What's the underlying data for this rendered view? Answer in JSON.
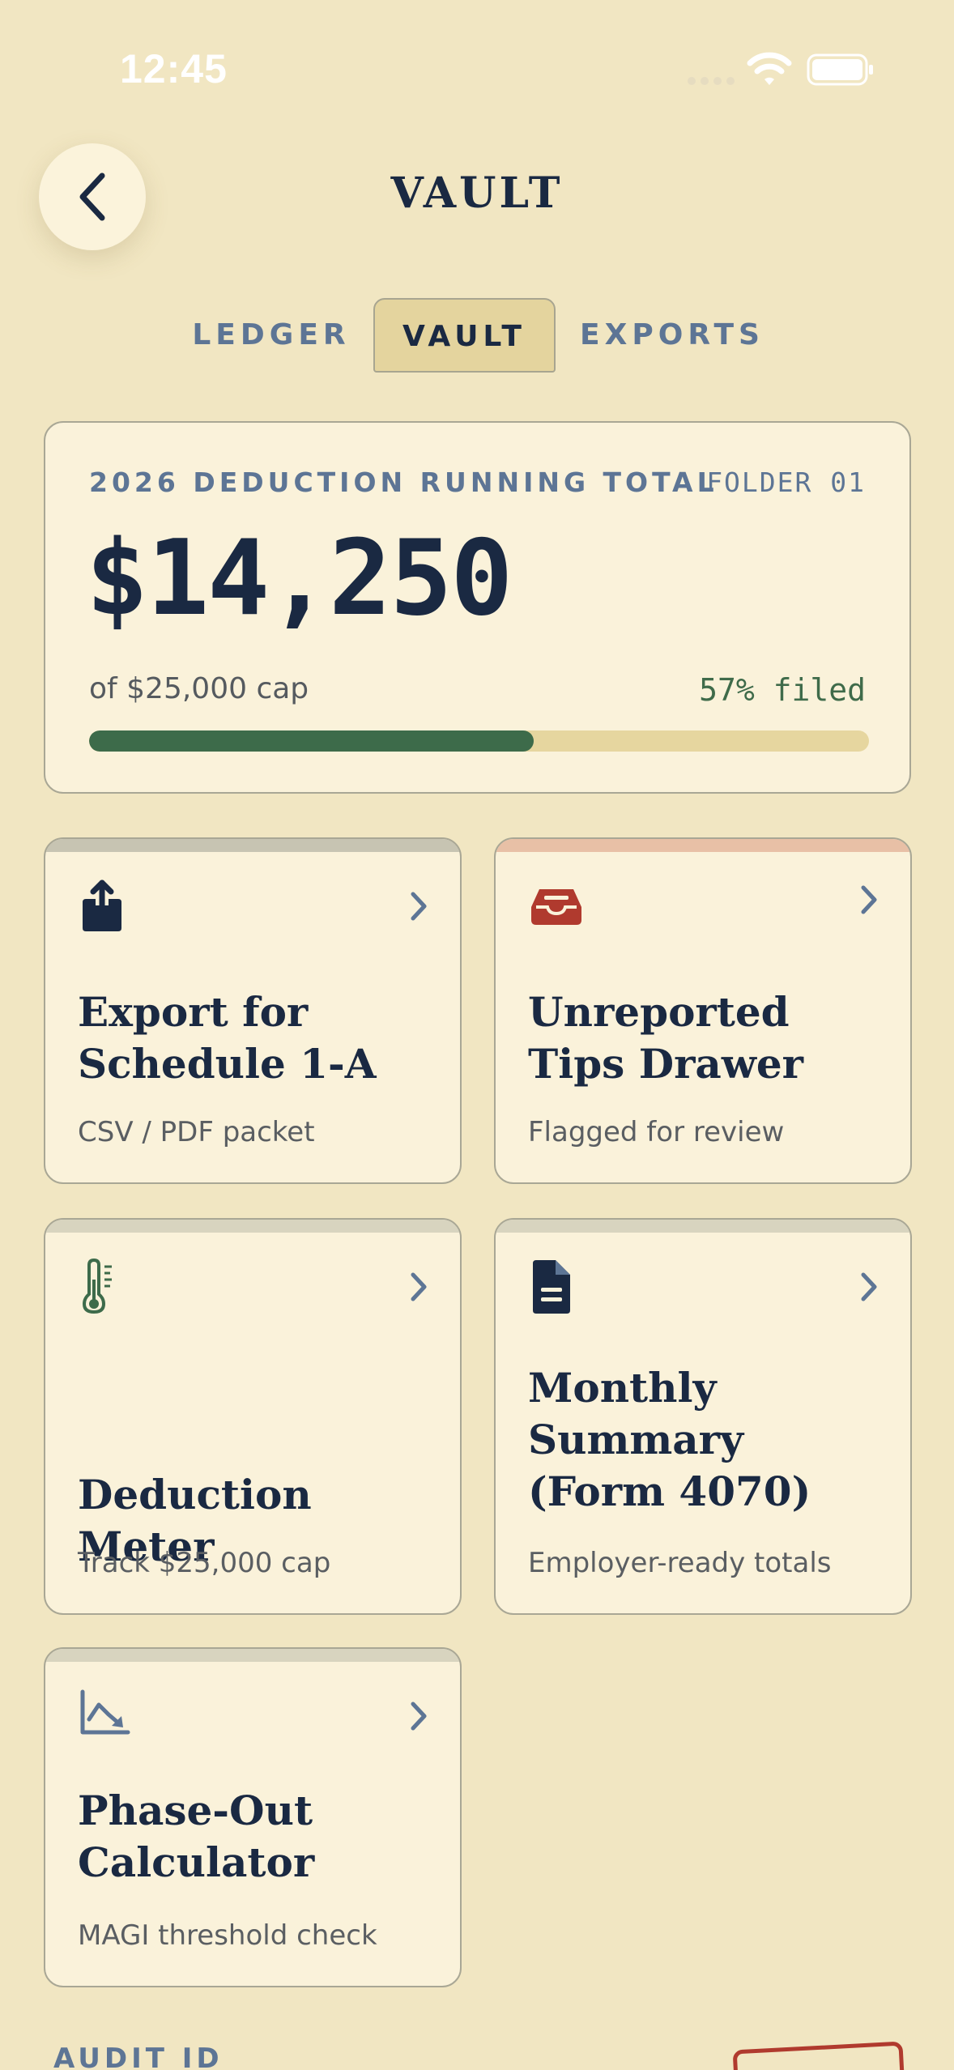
{
  "status_bar": {
    "time": "12:45"
  },
  "header": {
    "title": "VAULT"
  },
  "tabs": [
    {
      "label": "LEDGER",
      "active": false
    },
    {
      "label": "VAULT",
      "active": true
    },
    {
      "label": "EXPORTS",
      "active": false
    }
  ],
  "summary": {
    "label": "2026 DEDUCTION RUNNING TOTAL",
    "folder": "FOLDER 01",
    "amount": "$14,250",
    "cap_text": "of $25,000 cap",
    "filed_text": "57% filed",
    "progress_fraction": 0.57
  },
  "tiles": [
    {
      "title": "Export for Schedule 1-A",
      "subtitle": "CSV / PDF packet",
      "icon": "share-export-icon",
      "accent": "#C7C4B2"
    },
    {
      "title": "Unreported Tips Drawer",
      "subtitle": "Flagged for review",
      "icon": "inbox-tray-icon",
      "accent": "#E8C0A6"
    },
    {
      "title": "Deduction Meter",
      "subtitle": "Track $25,000 cap",
      "icon": "thermometer-icon",
      "accent": "#D8D4BF"
    },
    {
      "title": "Monthly Summary (Form 4070)",
      "subtitle": "Employer-ready totals",
      "icon": "document-icon",
      "accent": "#D8D4BF"
    },
    {
      "title": "Phase-Out Calculator",
      "subtitle": "MAGI threshold check",
      "icon": "chart-down-icon",
      "accent": "#D8D4BF"
    }
  ],
  "footer": {
    "audit_label": "AUDIT ID"
  },
  "colors": {
    "background": "#F1E6C2",
    "card": "#FAF2DA",
    "navy": "#1A2942",
    "slate": "#5D7595",
    "green": "#3D6B4A",
    "red": "#B03A2E",
    "tab_active": "#E4D49E"
  }
}
